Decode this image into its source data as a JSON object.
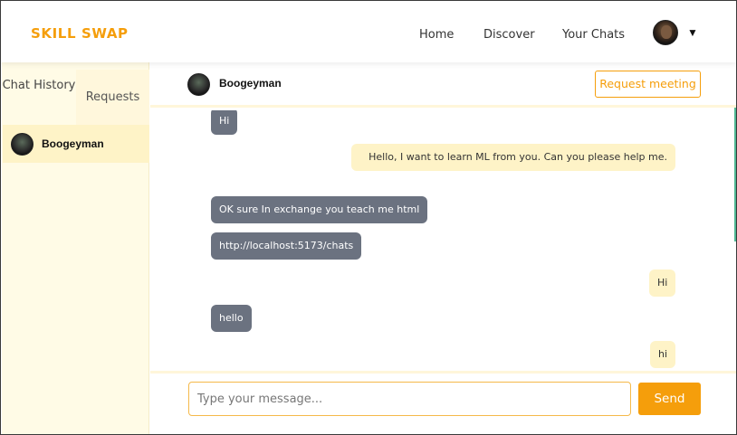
{
  "app": {
    "logo": "SKILL SWAP",
    "accent_color": "#f59e0b"
  },
  "nav": {
    "home": "Home",
    "discover": "Discover",
    "your_chats": "Your Chats",
    "avatar_icon": "user-avatar",
    "caret": "▼"
  },
  "sidebar": {
    "tabs": {
      "history": "Chat History",
      "requests": "Requests"
    },
    "contacts": [
      {
        "name": "Boogeyman"
      }
    ]
  },
  "chat": {
    "header": {
      "name": "Boogeyman",
      "request_meeting": "Request meeting"
    },
    "messages": [
      {
        "from": "them",
        "text": "Hi"
      },
      {
        "from": "me",
        "text": "Hello, I want to learn ML from you. Can you please help me."
      },
      {
        "from": "them",
        "text": "OK sure In exchange you teach me html"
      },
      {
        "from": "them",
        "text": "http://localhost:5173/chats"
      },
      {
        "from": "me",
        "text": "Hi"
      },
      {
        "from": "them",
        "text": "hello"
      },
      {
        "from": "me",
        "text": "hi"
      }
    ],
    "composer": {
      "placeholder": "Type your message...",
      "send": "Send"
    }
  }
}
